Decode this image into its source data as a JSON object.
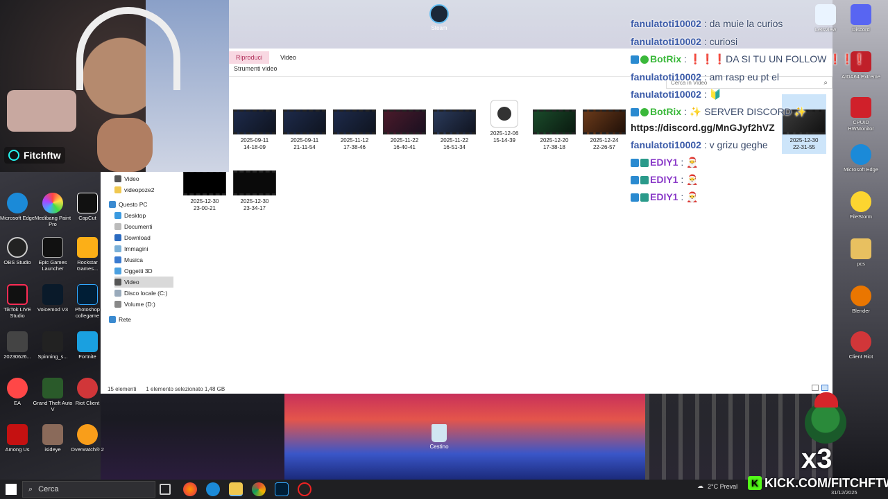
{
  "stream": {
    "tiktok_handle": "Fitchftw",
    "kick_url": "KICK.COM/FITCHFTW",
    "multiplier": "x3"
  },
  "desktop_top": {
    "steam_label": "Steam"
  },
  "explorer": {
    "tabs": [
      {
        "label": "Riproduci"
      },
      {
        "label": "Video"
      }
    ],
    "subtab": "Strumenti video",
    "search_placeholder": "Cerca in Video",
    "nav": [
      {
        "label": "Video"
      },
      {
        "label": "videopoze2"
      },
      {
        "label": "Questo PC"
      },
      {
        "label": "Desktop"
      },
      {
        "label": "Documenti"
      },
      {
        "label": "Download"
      },
      {
        "label": "Immagini"
      },
      {
        "label": "Musica"
      },
      {
        "label": "Oggetti 3D"
      },
      {
        "label": "Video"
      },
      {
        "label": "Disco locale (C:)"
      },
      {
        "label": "Volume (D:)"
      },
      {
        "label": "Rete"
      }
    ],
    "files": [
      {
        "date": "2025-09-11",
        "time": "14-18-09"
      },
      {
        "date": "2025-09-11",
        "time": "21-11-54"
      },
      {
        "date": "2025-11-12",
        "time": "17-38-46"
      },
      {
        "date": "2025-11-22",
        "time": "16-40-41"
      },
      {
        "date": "2025-11-22",
        "time": "16-51-34"
      },
      {
        "date": "2025-12-06",
        "time": "15-14-39"
      },
      {
        "date": "2025-12-20",
        "time": "17-38-18"
      },
      {
        "date": "2025-12-24",
        "time": "22-26-57"
      },
      {
        "date": "2025-12-30",
        "time": "22-31-55"
      },
      {
        "date": "2025-12-30",
        "time": "23-00-21"
      },
      {
        "date": "2025-12-30",
        "time": "23-34-17"
      }
    ],
    "status_count": "15 elementi",
    "status_selection": "1 elemento selezionato  1,48 GB"
  },
  "chat": [
    {
      "user": "fanulatoti10002",
      "text": ": da muie la curios"
    },
    {
      "user": "fanulatoti10002",
      "text": ": curiosi"
    },
    {
      "user": "BotRix",
      "text": ": ❗❗❗DA SI TU UN FOLLOW ❗❗❗"
    },
    {
      "user": "fanulatoti10002",
      "text": ": am rasp eu pt el"
    },
    {
      "user": "fanulatoti10002",
      "text": ":"
    },
    {
      "user": "BotRix",
      "text": ": ✨ SERVER DISCORD ✨"
    },
    {
      "user": "",
      "text": "https://discord.gg/MnGJyf2hVZ"
    },
    {
      "user": "fanulatoti10002",
      "text": ": v grizu geghe"
    },
    {
      "user": "EDIY1",
      "text": ":"
    },
    {
      "user": "EDIY1",
      "text": ":"
    },
    {
      "user": "EDIY1",
      "text": ":"
    }
  ],
  "desktop_left": [
    {
      "label": "Microsoft Edge"
    },
    {
      "label": "Medibang Paint Pro"
    },
    {
      "label": "CapCut"
    },
    {
      "label": "OBS Studio"
    },
    {
      "label": "Epic Games Launcher"
    },
    {
      "label": "Rockstar Games..."
    },
    {
      "label": "TikTok LIVE Studio"
    },
    {
      "label": "Voicemod V3"
    },
    {
      "label": "Photoshop collegame"
    },
    {
      "label": "20230626..."
    },
    {
      "label": "Spinning_s..."
    },
    {
      "label": "Fortnite"
    },
    {
      "label": "EA"
    },
    {
      "label": "Grand Theft Auto V"
    },
    {
      "label": "Riot Client"
    },
    {
      "label": "Among Us"
    },
    {
      "label": "isideye"
    },
    {
      "label": "Overwatch® 2"
    }
  ],
  "desktop_right": [
    {
      "label": "LetsView"
    },
    {
      "label": "Discord"
    },
    {
      "label": "AIDA64 Extreme"
    },
    {
      "label": "CPUID HWMonitor"
    },
    {
      "label": "Microsoft Edge"
    },
    {
      "label": "FileStorm"
    },
    {
      "label": "pcs"
    },
    {
      "label": "Blender"
    },
    {
      "label": "Client Riot"
    }
  ],
  "desktop_bottom": {
    "recycle_label": "Cestino"
  },
  "taskbar": {
    "search_label": "Cerca",
    "weather": "2°C  Preval",
    "date": "31/12/2025"
  },
  "colors": {
    "accent_select": "#cde5fa",
    "context_tab": "#f8d8e2",
    "kick_green": "#53fc18"
  }
}
